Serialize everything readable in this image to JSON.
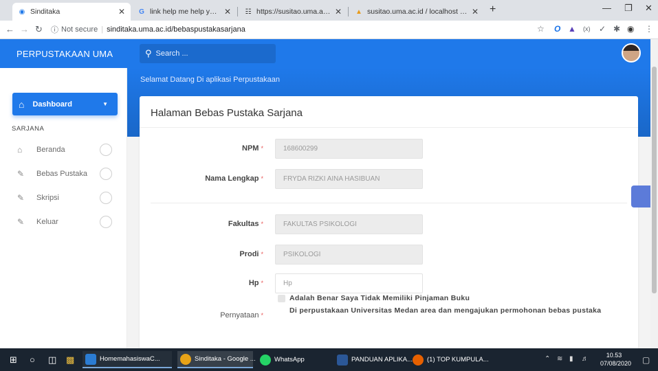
{
  "browser": {
    "tabs": [
      {
        "title": "Sinditaka",
        "active": true
      },
      {
        "title": "link help me help you - Penelusu",
        "active": false
      },
      {
        "title": "https://susitao.uma.ac.id/Telegra",
        "active": false
      },
      {
        "title": "susitao.uma.ac.id / localhost / su",
        "active": false
      }
    ],
    "not_secure": "Not secure",
    "url": "sinditaka.uma.ac.id/bebaspustakasarjana"
  },
  "app": {
    "brand": "PERPUSTAKAAN UMA",
    "search_placeholder": "Search ...",
    "welcome": "Selamat Datang Di aplikasi Perpustakaan",
    "sidebar": {
      "dashboard": "Dashboard",
      "section": "SARJANA",
      "items": [
        {
          "label": "Beranda",
          "icon": "home-icon"
        },
        {
          "label": "Bebas Pustaka",
          "icon": "edit-icon"
        },
        {
          "label": "Skripsi",
          "icon": "edit-icon"
        },
        {
          "label": "Keluar",
          "icon": "edit-icon"
        }
      ]
    },
    "form": {
      "title": "Halaman Bebas Pustaka Sarjana",
      "required_mark": "*",
      "fields": {
        "npm": {
          "label": "NPM",
          "value": "168600299"
        },
        "nama": {
          "label": "Nama Lengkap",
          "value": "FRYDA RIZKI AINA HASIBUAN"
        },
        "fakultas": {
          "label": "Fakultas",
          "value": "FAKULTAS PSIKOLOGI"
        },
        "prodi": {
          "label": "Prodi",
          "value": "PSIKOLOGI"
        },
        "hp": {
          "label": "Hp",
          "placeholder": "Hp"
        }
      },
      "pernyataan": {
        "label": "Pernyataan",
        "line1": "Adalah Benar Saya Tidak Memiliki Pinjaman Buku",
        "line2": "Di perpustakaan Universitas Medan area dan mengajukan permohonan bebas pustaka"
      }
    }
  },
  "taskbar": {
    "apps": [
      {
        "label": "HomemahasiswaC...",
        "color": "#2b7cd3"
      },
      {
        "label": "Sinditaka - Google ...",
        "color": "#e8a317"
      },
      {
        "label": "WhatsApp",
        "color": "#25d366"
      },
      {
        "label": "PANDUAN APLIKA...",
        "color": "#2b5797"
      },
      {
        "label": "(1) TOP KUMPULA...",
        "color": "#e66000"
      }
    ],
    "time": "10.53",
    "date": "07/08/2020"
  },
  "colors": {
    "primary": "#1f79ea",
    "required": "#e85a5a"
  }
}
